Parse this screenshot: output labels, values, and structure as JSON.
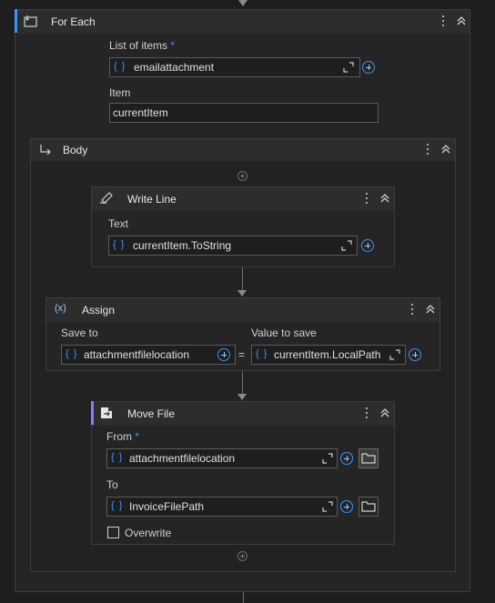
{
  "for_each": {
    "title": "For Each",
    "list_label": "List of items",
    "required_mark": "*",
    "list_value": "emailattachment",
    "item_label": "Item",
    "item_value": "currentItem"
  },
  "body": {
    "title": "Body"
  },
  "write_line": {
    "title": "Write Line",
    "text_label": "Text",
    "text_value": "currentItem.ToString"
  },
  "assign": {
    "title": "Assign",
    "icon_glyph": "(x)",
    "save_to_label": "Save to",
    "save_to_value": "attachmentfilelocation",
    "equals": "=",
    "value_label": "Value to save",
    "value_value": "currentItem.LocalPath"
  },
  "move_file": {
    "title": "Move File",
    "from_label": "From",
    "required_mark": "*",
    "from_value": "attachmentfilelocation",
    "to_label": "To",
    "to_value": "InvoiceFilePath",
    "overwrite_label": "Overwrite",
    "overwrite_checked": false
  },
  "brace_glyph": "{ }",
  "colors": {
    "accent": "#3794ff",
    "move_file_accent": "#8a7cff",
    "background": "#1e1e1e",
    "card": "#252526"
  },
  "icons": [
    "foreach-icon",
    "body-arrow-icon",
    "write-line-icon",
    "assign-icon",
    "move-file-icon",
    "kebab-menu-icon",
    "collapse-icon",
    "expand-editor-icon",
    "add-plus-icon",
    "folder-icon"
  ]
}
